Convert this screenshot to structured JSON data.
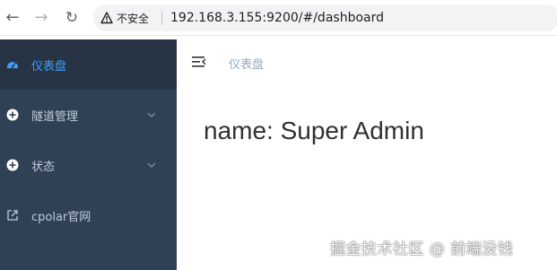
{
  "browser": {
    "security_label": "不安全",
    "url": "192.168.3.155:9200/#/dashboard"
  },
  "sidebar": {
    "items": [
      {
        "label": "仪表盘",
        "icon": "dashboard-icon",
        "active": true
      },
      {
        "label": "隧道管理",
        "icon": "plus-circle-icon",
        "expandable": true
      },
      {
        "label": "状态",
        "icon": "plus-circle-icon",
        "expandable": true
      },
      {
        "label": "cpolar官网",
        "icon": "external-link-icon"
      }
    ]
  },
  "navbar": {
    "breadcrumb": "仪表盘"
  },
  "dashboard": {
    "text": "name: Super Admin"
  },
  "watermark": "掘金技术社区 @ 前端没钱",
  "colors": {
    "sidebar_bg": "#304156",
    "sidebar_active_bg": "#263445",
    "active_text": "#409eff",
    "sidebar_text": "#bfcbd9"
  }
}
